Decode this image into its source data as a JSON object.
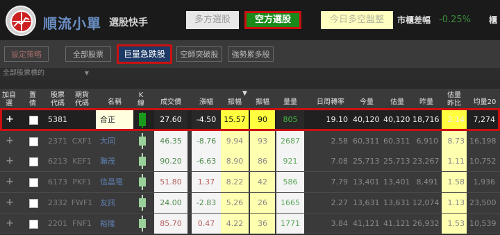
{
  "header": {
    "brand": "順流小單",
    "brand_sub": "選股快手",
    "btn_long": "多方選股",
    "btn_short": "空方選股",
    "status_btn": "今日多空盤整",
    "market_label": "市櫃差幅",
    "market_value": "-0.25%",
    "cut_label": "櫃"
  },
  "tabs": {
    "setting": "設定策略",
    "all": "全部股票",
    "active": "巨量急跌股",
    "t4": "空師突破股",
    "t5": "強勢累多股"
  },
  "filter": {
    "placeholder": "全部股票標的"
  },
  "columns": {
    "add": "加自\n選",
    "inv": "置\n倩",
    "stock_code": "股票\n代碼",
    "futures_code": "期貨\n代碼",
    "name": "名稱",
    "k": "K\n線",
    "price": "成交價",
    "change": "漲幅",
    "amp1": "振幅",
    "amp2": "振幅",
    "volume": "量量",
    "turnover": "日周轉率",
    "vol_today": "今量",
    "est_vol": "估量",
    "prev_vol": "昨量",
    "est_ratio": "估量\n昨比",
    "avg20": "均量20"
  },
  "rows": [
    {
      "stock": "5381",
      "fut": "",
      "name": "合正",
      "price": "27.60",
      "chg": "-4.50",
      "a1": "15.57",
      "a2": "90",
      "vol": "805",
      "turn": "19.10",
      "today": "40,120",
      "est": "40,120",
      "prev": "18,716",
      "ratio": "2.14",
      "avg": "7,274",
      "dir": "down"
    },
    {
      "stock": "2371",
      "fut": "CXF1",
      "name": "大同",
      "price": "46.35",
      "chg": "-8.76",
      "a1": "9.94",
      "a2": "93",
      "vol": "2687",
      "turn": "2.58",
      "today": "60,311",
      "est": "60,311",
      "prev": "6,910",
      "ratio": "8.73",
      "avg": "16,198",
      "dir": "down"
    },
    {
      "stock": "6213",
      "fut": "KEF1",
      "name": "聯茂",
      "price": "90.20",
      "chg": "-6.63",
      "a1": "8.90",
      "a2": "86",
      "vol": "921",
      "turn": "7.08",
      "today": "25,713",
      "est": "25,713",
      "prev": "23,267",
      "ratio": "1.11",
      "avg": "10,752",
      "dir": "down"
    },
    {
      "stock": "6173",
      "fut": "PKF1",
      "name": "信昌電",
      "price": "51.80",
      "chg": "1.37",
      "a1": "8.22",
      "a2": "42",
      "vol": "586",
      "turn": "7.79",
      "today": "13,401",
      "est": "13,401",
      "prev": "8,491",
      "ratio": "1.58",
      "avg": "1,936",
      "dir": "up"
    },
    {
      "stock": "2332",
      "fut": "FWF1",
      "name": "友訊",
      "price": "24.00",
      "chg": "-2.83",
      "a1": "5.26",
      "a2": "26",
      "vol": "1665",
      "turn": "2.27",
      "today": "13,631",
      "est": "13,631",
      "prev": "12,074",
      "ratio": "1.13",
      "avg": "23,500",
      "dir": "down"
    },
    {
      "stock": "2201",
      "fut": "FNF1",
      "name": "裕隆",
      "price": "85.70",
      "chg": "0.47",
      "a1": "4.22",
      "a2": "36",
      "vol": "1771",
      "turn": "3.84",
      "today": "41,121",
      "est": "41,121",
      "prev": "26,932",
      "ratio": "1.53",
      "avg": "10,539",
      "dir": "up"
    }
  ],
  "colors": {
    "accent": "#cc1010",
    "green": "#1a8a1a",
    "yellow": "#ffff40"
  }
}
